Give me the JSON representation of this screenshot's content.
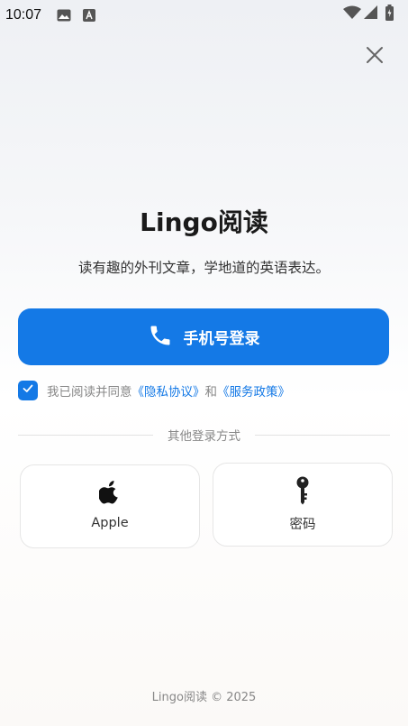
{
  "status_bar": {
    "time": "10:07",
    "icons": [
      "gallery-icon",
      "a-notification-icon",
      "wifi-icon",
      "signal-icon",
      "battery-charging-icon"
    ]
  },
  "close_icon": "close-icon",
  "app": {
    "title": "Lingo阅读",
    "subtitle": "读有趣的外刊文章，学地道的英语表达。"
  },
  "phone_login": {
    "label": "手机号登录",
    "icon": "phone-icon"
  },
  "agreement": {
    "checked": true,
    "prefix": "我已阅读并同意",
    "privacy_link": "《隐私协议》",
    "conjunction": "和",
    "service_link": "《服务政策》"
  },
  "divider": {
    "label": "其他登录方式"
  },
  "alt_logins": [
    {
      "label": "Apple",
      "icon": "apple-icon"
    },
    {
      "label": "密码",
      "icon": "key-icon"
    }
  ],
  "footer": {
    "text": "Lingo阅读 © 2025"
  },
  "colors": {
    "accent": "#1479e6",
    "text_primary": "#1a1a1a",
    "text_muted": "#888888"
  }
}
